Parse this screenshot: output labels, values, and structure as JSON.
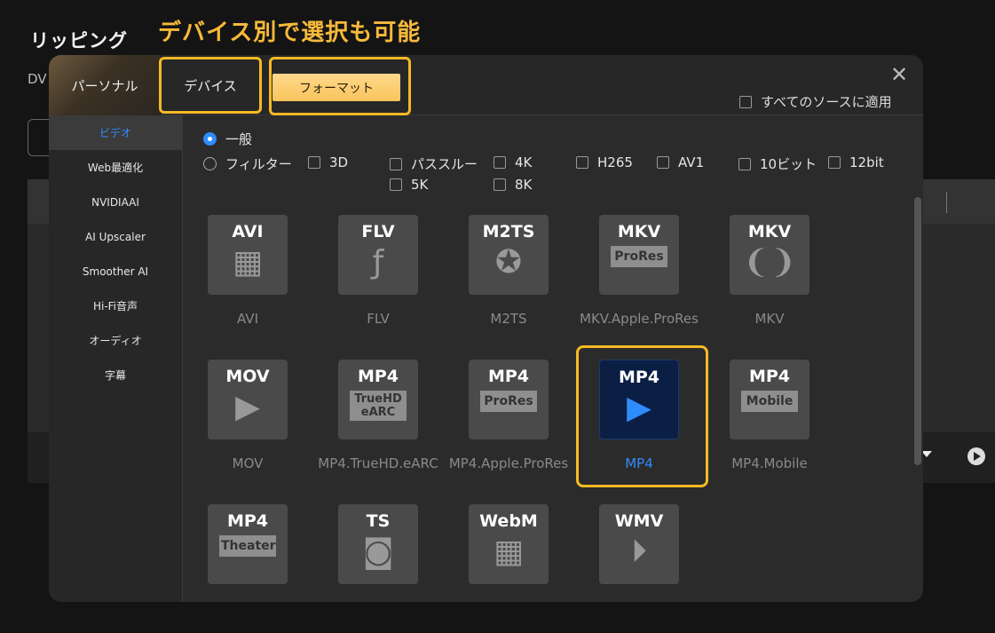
{
  "background": {
    "title": "リッピング",
    "dv_label": "DV"
  },
  "annotation": "デバイス別で選択も可能",
  "modal": {
    "tabs": {
      "personal": "パーソナル",
      "device": "デバイス",
      "format": "フォーマット"
    },
    "close_icon": "close-icon",
    "apply_all": "すべてのソースに適用"
  },
  "sidebar": {
    "items": [
      {
        "label": "ビデオ",
        "active": true
      },
      {
        "label": "Web最適化"
      },
      {
        "label": "NVIDIAAI"
      },
      {
        "label": "AI Upscaler"
      },
      {
        "label": "Smoother AI"
      },
      {
        "label": "Hi-Fi音声"
      },
      {
        "label": "オーディオ"
      },
      {
        "label": "字幕"
      }
    ]
  },
  "filters": {
    "general": "一般",
    "filter": "フィルター",
    "checks": [
      "3D",
      "パススルー",
      "4K",
      "H265",
      "AV1",
      "10ビット",
      "12bit",
      "5K",
      "8K"
    ]
  },
  "formats": [
    {
      "name": "AVI",
      "label": "AVI",
      "icon": "film-strip-icon"
    },
    {
      "name": "FLV",
      "label": "FLV",
      "icon": "flash-icon"
    },
    {
      "name": "M2TS",
      "label": "M2TS",
      "icon": "film-reel-icon"
    },
    {
      "name": "MKV",
      "label": "MKV.Apple.ProRes",
      "sub": "ProRes"
    },
    {
      "name": "MKV",
      "label": "MKV",
      "icon": "matroska-icon"
    },
    {
      "name": "MOV",
      "label": "MOV",
      "icon": "clapper-play-icon"
    },
    {
      "name": "MP4",
      "label": "MP4.TrueHD.eARC",
      "sub1": "TrueHD",
      "sub2": "eARC"
    },
    {
      "name": "MP4",
      "label": "MP4.Apple.ProRes",
      "sub": "ProRes"
    },
    {
      "name": "MP4",
      "label": "MP4",
      "icon": "clapper-play-icon",
      "selected": true
    },
    {
      "name": "MP4",
      "label": "MP4.Mobile",
      "sub": "Mobile"
    },
    {
      "name": "MP4",
      "label": "",
      "sub": "Theater"
    },
    {
      "name": "TS",
      "label": "",
      "icon": "video-camera-icon"
    },
    {
      "name": "WebM",
      "label": "",
      "icon": "film-strip-icon"
    },
    {
      "name": "WMV",
      "label": "",
      "icon": "play-circle-icon"
    }
  ],
  "colors": {
    "accent": "#2f8cff",
    "highlight": "#f7b924",
    "format_tab": "#f8c45d"
  }
}
